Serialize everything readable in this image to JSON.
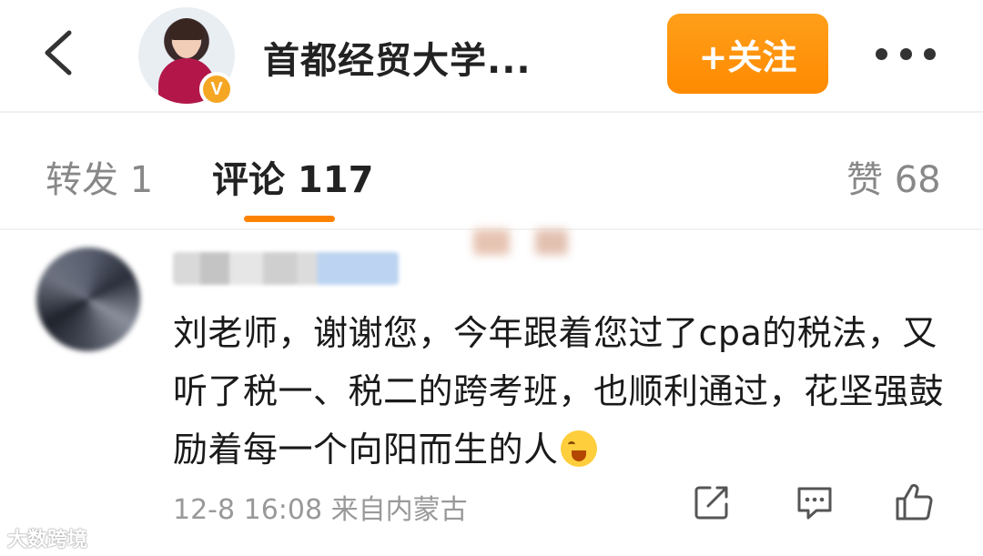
{
  "header": {
    "title": "首都经贸大学...",
    "follow_label": "+关注",
    "verified_badge": "V"
  },
  "tabs": {
    "repost": "转发 1",
    "comments": "评论 117",
    "likes": "赞 68"
  },
  "comment": {
    "text": "刘老师，谢谢您，今年跟着您过了cpa的税法，又听了税一、税二的跨考班，也顺利通过，花坚强鼓励着每一个向阳而生的人",
    "meta": "12-8 16:08 来自内蒙古"
  },
  "watermark": "大数跨境",
  "colors": {
    "accent": "#ff8200",
    "follow_button": "#ff9f1a",
    "verified_badge": "#f5a623"
  },
  "icons": [
    "back-icon",
    "more-icon",
    "share-icon",
    "comment-icon",
    "like-icon",
    "emoji-icon"
  ]
}
